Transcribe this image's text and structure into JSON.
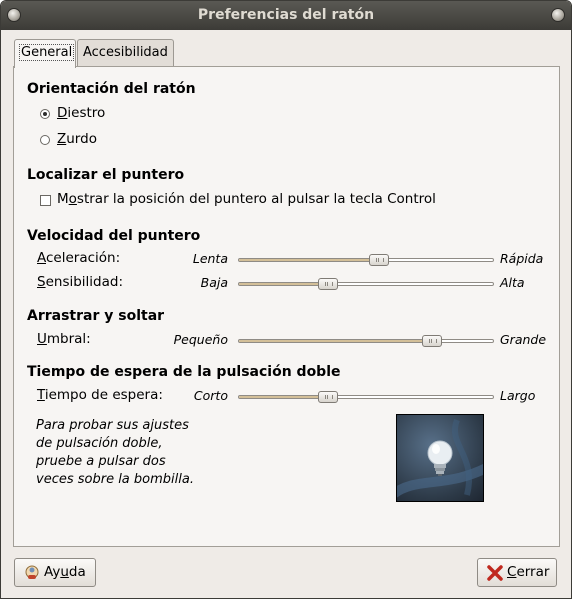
{
  "window": {
    "title": "Preferencias del ratón"
  },
  "tabs": [
    {
      "label": "General",
      "active": true
    },
    {
      "label": "Accesibilidad",
      "active": false
    }
  ],
  "orientation": {
    "heading": "Orientación del ratón",
    "options": [
      {
        "label": "Diestro",
        "mnemonic": "D",
        "rest": "iestro",
        "selected": true
      },
      {
        "label": "Zurdo",
        "mnemonic": "Z",
        "rest": "urdo",
        "selected": false
      }
    ]
  },
  "locate": {
    "heading": "Localizar el puntero",
    "checkbox": {
      "label": "Mostrar la posición del puntero al pulsar la tecla Control",
      "pre": "M",
      "mnemonic": "o",
      "rest": "strar la posición del puntero al pulsar la tecla Control",
      "checked": false
    }
  },
  "speed": {
    "heading": "Velocidad del puntero",
    "sliders": [
      {
        "label": "Aceleración:",
        "mnemonic": "A",
        "rest": "celeración:",
        "min_label": "Lenta",
        "max_label": "Rápida",
        "value": 0.55
      },
      {
        "label": "Sensibilidad:",
        "mnemonic": "S",
        "rest": "ensibilidad:",
        "min_label": "Baja",
        "max_label": "Alta",
        "value": 0.35
      }
    ]
  },
  "drag": {
    "heading": "Arrastrar y soltar",
    "slider": {
      "label": "Umbral:",
      "mnemonic": "U",
      "rest": "mbral:",
      "min_label": "Pequeño",
      "max_label": "Grande",
      "value": 0.76
    }
  },
  "double_click": {
    "heading": "Tiempo de espera de la pulsación doble",
    "slider": {
      "label": "Tiempo de espera:",
      "mnemonic": "T",
      "rest": "iempo de espera:",
      "min_label": "Corto",
      "max_label": "Largo",
      "value": 0.35
    },
    "help_text": "Para probar sus ajustes de pulsación doble, pruebe a pulsar dos veces sobre la bombilla."
  },
  "buttons": {
    "help": {
      "label": "Ayuda",
      "pre": "Ay",
      "mnemonic": "u",
      "rest": "da"
    },
    "close": {
      "label": "Cerrar",
      "mnemonic": "C",
      "rest": "errar"
    }
  },
  "colors": {
    "titlebar": "#3c3b37",
    "slider_fill": "#d3bf98",
    "window_bg": "#efebe7"
  },
  "icons": [
    "help-icon",
    "close-x-icon",
    "lightbulb-icon"
  ]
}
